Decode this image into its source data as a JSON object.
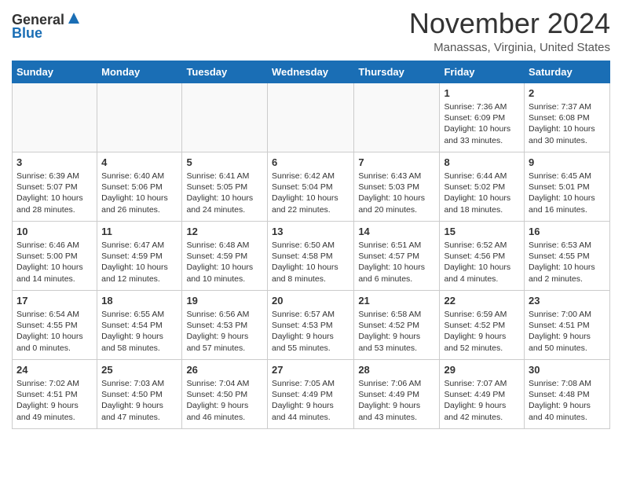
{
  "header": {
    "logo_general": "General",
    "logo_blue": "Blue",
    "month": "November 2024",
    "location": "Manassas, Virginia, United States"
  },
  "weekdays": [
    "Sunday",
    "Monday",
    "Tuesday",
    "Wednesday",
    "Thursday",
    "Friday",
    "Saturday"
  ],
  "weeks": [
    [
      {
        "day": "",
        "info": ""
      },
      {
        "day": "",
        "info": ""
      },
      {
        "day": "",
        "info": ""
      },
      {
        "day": "",
        "info": ""
      },
      {
        "day": "",
        "info": ""
      },
      {
        "day": "1",
        "info": "Sunrise: 7:36 AM\nSunset: 6:09 PM\nDaylight: 10 hours\nand 33 minutes."
      },
      {
        "day": "2",
        "info": "Sunrise: 7:37 AM\nSunset: 6:08 PM\nDaylight: 10 hours\nand 30 minutes."
      }
    ],
    [
      {
        "day": "3",
        "info": "Sunrise: 6:39 AM\nSunset: 5:07 PM\nDaylight: 10 hours\nand 28 minutes."
      },
      {
        "day": "4",
        "info": "Sunrise: 6:40 AM\nSunset: 5:06 PM\nDaylight: 10 hours\nand 26 minutes."
      },
      {
        "day": "5",
        "info": "Sunrise: 6:41 AM\nSunset: 5:05 PM\nDaylight: 10 hours\nand 24 minutes."
      },
      {
        "day": "6",
        "info": "Sunrise: 6:42 AM\nSunset: 5:04 PM\nDaylight: 10 hours\nand 22 minutes."
      },
      {
        "day": "7",
        "info": "Sunrise: 6:43 AM\nSunset: 5:03 PM\nDaylight: 10 hours\nand 20 minutes."
      },
      {
        "day": "8",
        "info": "Sunrise: 6:44 AM\nSunset: 5:02 PM\nDaylight: 10 hours\nand 18 minutes."
      },
      {
        "day": "9",
        "info": "Sunrise: 6:45 AM\nSunset: 5:01 PM\nDaylight: 10 hours\nand 16 minutes."
      }
    ],
    [
      {
        "day": "10",
        "info": "Sunrise: 6:46 AM\nSunset: 5:00 PM\nDaylight: 10 hours\nand 14 minutes."
      },
      {
        "day": "11",
        "info": "Sunrise: 6:47 AM\nSunset: 4:59 PM\nDaylight: 10 hours\nand 12 minutes."
      },
      {
        "day": "12",
        "info": "Sunrise: 6:48 AM\nSunset: 4:59 PM\nDaylight: 10 hours\nand 10 minutes."
      },
      {
        "day": "13",
        "info": "Sunrise: 6:50 AM\nSunset: 4:58 PM\nDaylight: 10 hours\nand 8 minutes."
      },
      {
        "day": "14",
        "info": "Sunrise: 6:51 AM\nSunset: 4:57 PM\nDaylight: 10 hours\nand 6 minutes."
      },
      {
        "day": "15",
        "info": "Sunrise: 6:52 AM\nSunset: 4:56 PM\nDaylight: 10 hours\nand 4 minutes."
      },
      {
        "day": "16",
        "info": "Sunrise: 6:53 AM\nSunset: 4:55 PM\nDaylight: 10 hours\nand 2 minutes."
      }
    ],
    [
      {
        "day": "17",
        "info": "Sunrise: 6:54 AM\nSunset: 4:55 PM\nDaylight: 10 hours\nand 0 minutes."
      },
      {
        "day": "18",
        "info": "Sunrise: 6:55 AM\nSunset: 4:54 PM\nDaylight: 9 hours\nand 58 minutes."
      },
      {
        "day": "19",
        "info": "Sunrise: 6:56 AM\nSunset: 4:53 PM\nDaylight: 9 hours\nand 57 minutes."
      },
      {
        "day": "20",
        "info": "Sunrise: 6:57 AM\nSunset: 4:53 PM\nDaylight: 9 hours\nand 55 minutes."
      },
      {
        "day": "21",
        "info": "Sunrise: 6:58 AM\nSunset: 4:52 PM\nDaylight: 9 hours\nand 53 minutes."
      },
      {
        "day": "22",
        "info": "Sunrise: 6:59 AM\nSunset: 4:52 PM\nDaylight: 9 hours\nand 52 minutes."
      },
      {
        "day": "23",
        "info": "Sunrise: 7:00 AM\nSunset: 4:51 PM\nDaylight: 9 hours\nand 50 minutes."
      }
    ],
    [
      {
        "day": "24",
        "info": "Sunrise: 7:02 AM\nSunset: 4:51 PM\nDaylight: 9 hours\nand 49 minutes."
      },
      {
        "day": "25",
        "info": "Sunrise: 7:03 AM\nSunset: 4:50 PM\nDaylight: 9 hours\nand 47 minutes."
      },
      {
        "day": "26",
        "info": "Sunrise: 7:04 AM\nSunset: 4:50 PM\nDaylight: 9 hours\nand 46 minutes."
      },
      {
        "day": "27",
        "info": "Sunrise: 7:05 AM\nSunset: 4:49 PM\nDaylight: 9 hours\nand 44 minutes."
      },
      {
        "day": "28",
        "info": "Sunrise: 7:06 AM\nSunset: 4:49 PM\nDaylight: 9 hours\nand 43 minutes."
      },
      {
        "day": "29",
        "info": "Sunrise: 7:07 AM\nSunset: 4:49 PM\nDaylight: 9 hours\nand 42 minutes."
      },
      {
        "day": "30",
        "info": "Sunrise: 7:08 AM\nSunset: 4:48 PM\nDaylight: 9 hours\nand 40 minutes."
      }
    ]
  ]
}
